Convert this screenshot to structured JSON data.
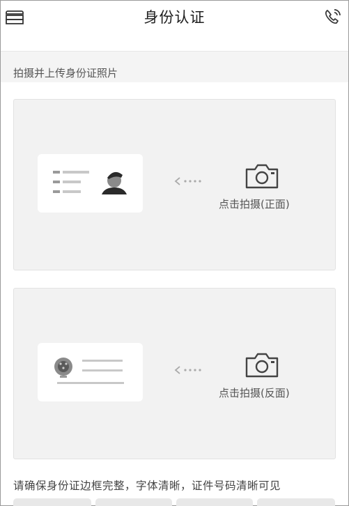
{
  "header": {
    "title": "身份认证",
    "left_icon": "menu-stack-icon",
    "right_icon": "phone-support-icon"
  },
  "section": {
    "label": "拍摄并上传身份证照片"
  },
  "front_card": {
    "capture_label": "点击拍摄(正面)",
    "illustration_icon": "id-card-portrait-icon",
    "camera_icon": "camera-icon",
    "arrow_icon": "dotted-arrow-left-icon"
  },
  "back_card": {
    "capture_label": "点击拍摄(反面)",
    "illustration_icon": "id-card-emblem-icon",
    "camera_icon": "camera-icon",
    "arrow_icon": "dotted-arrow-left-icon"
  },
  "hint": "请确保身份证边框完整，字体清晰，证件号码清晰可见",
  "colors": {
    "card_bg": "#f2f2f2",
    "label_bg": "#f4f4f4",
    "icon_gray": "#8a8a8a",
    "text_dark": "#1e1e1e"
  }
}
